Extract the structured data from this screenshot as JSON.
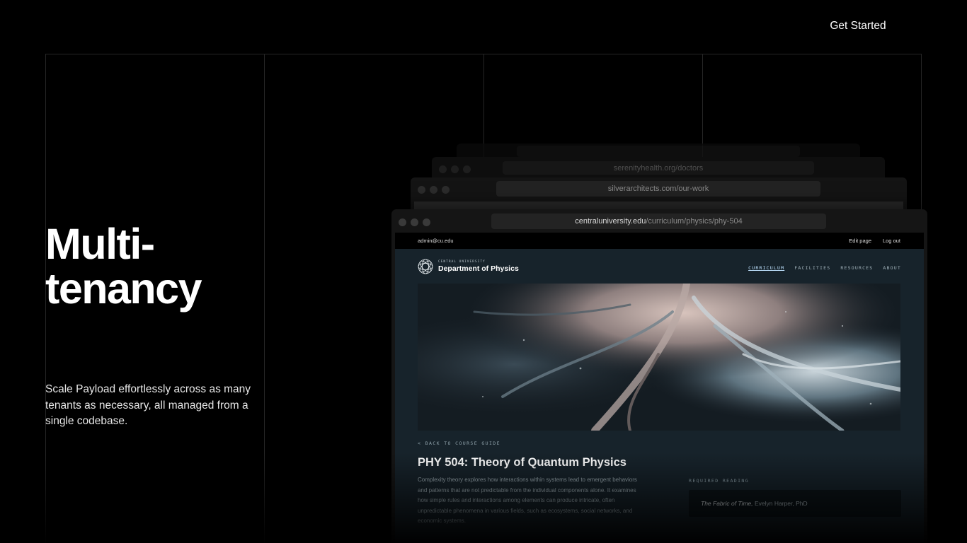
{
  "header": {
    "cta_label": "Get Started"
  },
  "hero": {
    "title_lines": [
      "Multi-",
      "tenancy"
    ],
    "description_lines": [
      "Scale Payload effortlessly across as many",
      "tenants as necessary, all managed from a",
      "single codebase."
    ]
  },
  "windows": {
    "back_urls": [
      "serenityhealth.org/doctors",
      "silverarchitects.com/our-work"
    ],
    "front": {
      "url_domain": "centraluniversity.edu",
      "url_path": "/curriculum/physics/phy-504"
    }
  },
  "site": {
    "adminbar": {
      "email": "admin@cu.edu",
      "edit": "Edit page",
      "logout": "Log out"
    },
    "logo": {
      "small": "CENTRAL UNIVERSITY",
      "big": "Department of Physics"
    },
    "nav": [
      "CURRICULUM",
      "FACILITIES",
      "RESOURCES",
      "ABOUT"
    ],
    "nav_active": "CURRICULUM",
    "back_link": "< BACK TO COURSE GUIDE",
    "course_title": "PHY 504: Theory of Quantum Physics",
    "body_lines": [
      "Complexity theory explores how interactions within systems lead to emergent behaviors",
      "and patterns that are not predictable from the individual components alone. It examines",
      "how simple rules and interactions among elements can produce intricate, often",
      "unpredictable phenomena in various fields, such as ecosystems, social networks, and",
      "economic systems."
    ],
    "required_reading_label": "REQUIRED READING",
    "reading": {
      "book": "The Fabric of Time,",
      "author": "Evelyn Harper, PhD"
    }
  },
  "colors": {
    "background": "#000000",
    "site_bg": "#17232b",
    "accent_nav": "#bfe2ff"
  },
  "icons": {
    "logo_mark": "globe-wireframe-icon"
  }
}
